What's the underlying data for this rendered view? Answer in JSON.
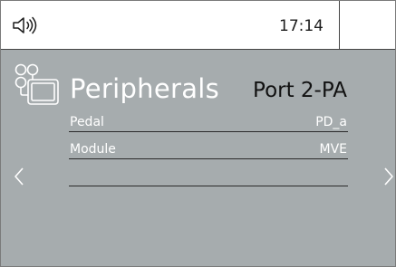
{
  "status_bar": {
    "time": "17:14",
    "icons": [
      "speaker-icon"
    ]
  },
  "page": {
    "title": "Peripherals",
    "port": "Port 2-PA",
    "icon": "peripherals-icon"
  },
  "rows": [
    {
      "label": "Pedal",
      "value": "PD_a"
    },
    {
      "label": "Module",
      "value": "MVE"
    },
    {
      "label": "",
      "value": ""
    }
  ],
  "navigation": {
    "prev_icon": "chevron-left-icon",
    "next_icon": "chevron-right-icon"
  },
  "colors": {
    "background": "#a6acae",
    "text_light": "#ffffff",
    "text_dark": "#111111"
  }
}
